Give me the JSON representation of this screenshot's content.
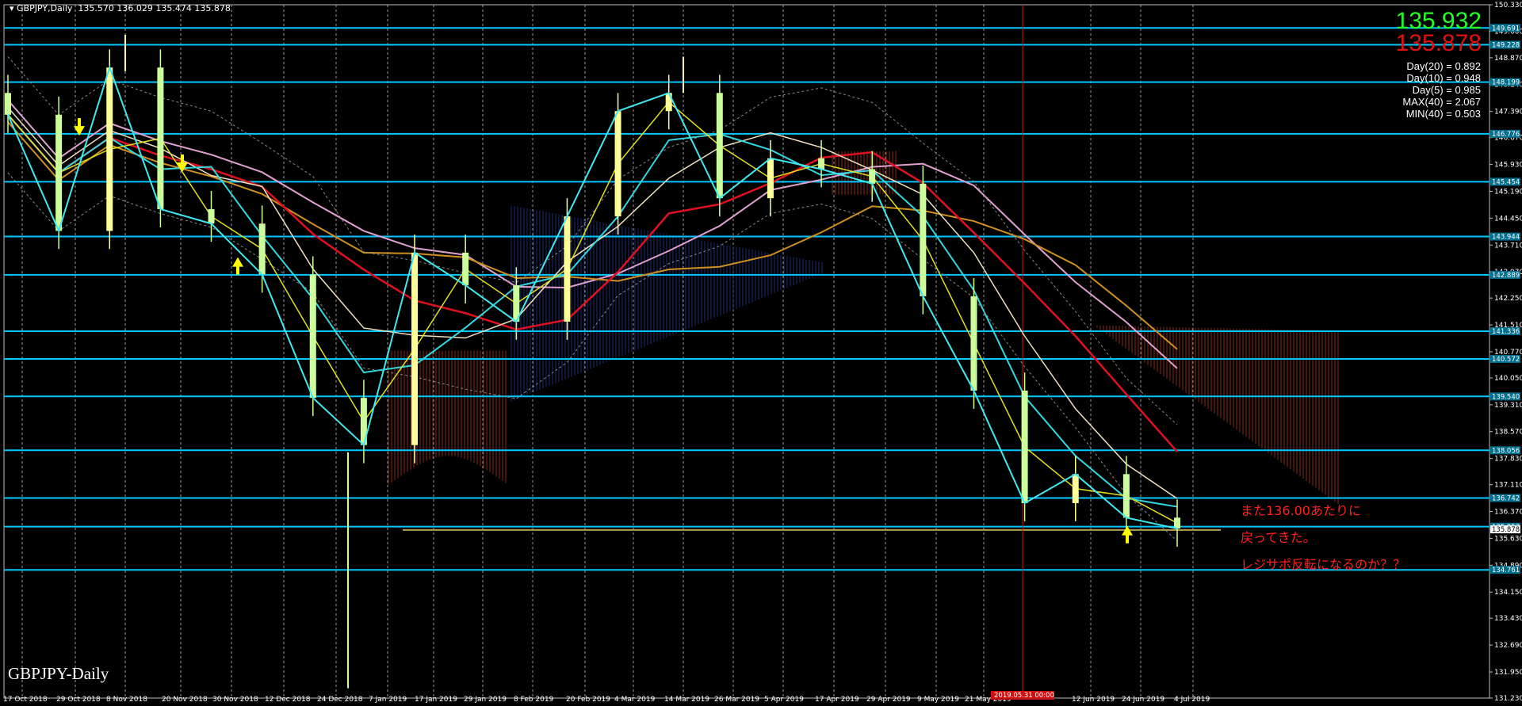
{
  "header": {
    "symbol_title": "GBPJPY,Daily",
    "ohlc": "135.570 136.029 135.474 135.878"
  },
  "quote": {
    "bid": "135.932",
    "ask": "135.878",
    "bid_color": "#22ff22",
    "ask_color": "#e01010"
  },
  "stats": [
    "Day(20) = 0.892",
    "Day(10) = 0.948",
    "Day(5) = 0.985",
    "MAX(40) = 2.067",
    "MIN(40) = 0.503"
  ],
  "footer_label": "GBPJPY-Daily",
  "annotation": [
    "また136.00あたりに",
    "戻ってきた。",
    "レジサポ反転になるのか？？"
  ],
  "marker_tag": "2019.05.31 00:00",
  "colors": {
    "background": "#000000",
    "horizontal_lines": "#00c8ff",
    "axis_text": "#ffffff",
    "bull_candle": "#ffff99",
    "bear_candle": "#ccff99",
    "ma_red": "#e01020",
    "ma_cyan": "#30d8e0",
    "ma_yellow": "#e0e020",
    "ma_orange": "#d09020",
    "ma_pink": "#e0a0d0",
    "ma_white": "#f0e0c0",
    "zigzag": "#40e8f0",
    "cloud_bear": "#c04020",
    "cloud_bull": "#3040a0",
    "annotation": "#ff2020"
  },
  "chart_data": {
    "type": "line",
    "title": "GBPJPY,Daily",
    "xlabel": "",
    "ylabel": "",
    "ylim": [
      131.23,
      150.33
    ],
    "grid": true,
    "y_ticks": [
      "150.330",
      "149.600",
      "148.870",
      "148.140",
      "147.390",
      "146.670",
      "145.930",
      "145.190",
      "144.450",
      "143.710",
      "142.970",
      "142.250",
      "141.510",
      "140.770",
      "140.050",
      "139.310",
      "138.570",
      "137.830",
      "137.110",
      "136.370",
      "135.630",
      "134.890",
      "134.150",
      "133.430",
      "132.690",
      "131.950",
      "131.230"
    ],
    "x_ticks": [
      "17 Oct 2018",
      "29 Oct 2018",
      "8 Nov 2018",
      "20 Nov 2018",
      "30 Nov 2018",
      "12 Dec 2018",
      "24 Dec 2018",
      "7 Jan 2019",
      "17 Jan 2019",
      "29 Jan 2019",
      "8 Feb 2019",
      "20 Feb 2019",
      "4 Mar 2019",
      "14 Mar 2019",
      "26 Mar 2019",
      "5 Apr 2019",
      "17 Apr 2019",
      "29 Apr 2019",
      "9 May 2019",
      "21 May 2019",
      "12 Jun 2019",
      "24 Jun 2019",
      "4 Jul 2019"
    ],
    "h_levels": [
      {
        "value": 149.691,
        "label": "149.691"
      },
      {
        "value": 149.228,
        "label": "149.228"
      },
      {
        "value": 148.199,
        "label": "148.199"
      },
      {
        "value": 146.776,
        "label": "146.776"
      },
      {
        "value": 145.454,
        "label": "145.454"
      },
      {
        "value": 143.944,
        "label": "143.944"
      },
      {
        "value": 142.889,
        "label": "142.889"
      },
      {
        "value": 141.336,
        "label": "141.336"
      },
      {
        "value": 140.572,
        "label": "140.572"
      },
      {
        "value": 139.54,
        "label": "139.540"
      },
      {
        "value": 138.056,
        "label": "138.056"
      },
      {
        "value": 136.742,
        "label": "136.742"
      },
      {
        "value": 135.953,
        "label": "135.953"
      },
      {
        "value": 134.761,
        "label": "134.761"
      }
    ],
    "price_tag": "135.878",
    "support_level": 135.86,
    "close_series": [
      {
        "date": "17 Oct 2018",
        "close": 147.3
      },
      {
        "date": "29 Oct 2018",
        "close": 144.1
      },
      {
        "date": "8 Nov 2018",
        "close": 148.6
      },
      {
        "date": "20 Nov 2018",
        "close": 144.7
      },
      {
        "date": "30 Nov 2018",
        "close": 144.3
      },
      {
        "date": "12 Dec 2018",
        "close": 142.9
      },
      {
        "date": "24 Dec 2018",
        "close": 139.5
      },
      {
        "date": "7 Jan 2019",
        "close": 138.2
      },
      {
        "date": "17 Jan 2019",
        "close": 143.5
      },
      {
        "date": "29 Jan 2019",
        "close": 142.6
      },
      {
        "date": "8 Feb 2019",
        "close": 141.6
      },
      {
        "date": "20 Feb 2019",
        "close": 144.5
      },
      {
        "date": "4 Mar 2019",
        "close": 147.4
      },
      {
        "date": "14 Mar 2019",
        "close": 147.9
      },
      {
        "date": "26 Mar 2019",
        "close": 145.0
      },
      {
        "date": "5 Apr 2019",
        "close": 146.1
      },
      {
        "date": "17 Apr 2019",
        "close": 145.8
      },
      {
        "date": "29 Apr 2019",
        "close": 145.4
      },
      {
        "date": "9 May 2019",
        "close": 142.3
      },
      {
        "date": "21 May 2019",
        "close": 139.7
      },
      {
        "date": "31 May 2019",
        "close": 136.6
      },
      {
        "date": "12 Jun 2019",
        "close": 137.4
      },
      {
        "date": "24 Jun 2019",
        "close": 136.2
      },
      {
        "date": "4 Jul 2019",
        "close": 135.9
      }
    ],
    "extreme_points": [
      {
        "date": "3 Jan 2019",
        "low": 131.5
      },
      {
        "date": "8 Nov 2018",
        "high": 149.5
      },
      {
        "date": "14 Mar 2019",
        "high": 148.9
      }
    ]
  }
}
